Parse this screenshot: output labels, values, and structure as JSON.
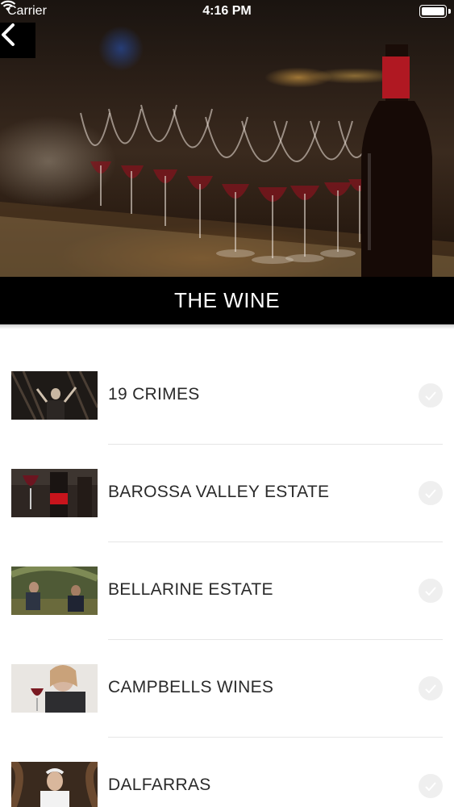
{
  "status_bar": {
    "carrier": "Carrier",
    "time": "4:16 PM"
  },
  "header": {
    "back_icon": "chevron-left-icon",
    "title": "THE WINE"
  },
  "wineries": [
    {
      "name": "19 CRIMES",
      "thumbnail": "photo-man-in-dark-studio",
      "checked": false
    },
    {
      "name": "BAROSSA VALLEY ESTATE",
      "thumbnail": "photo-wine-glass-and-bottle",
      "checked": false
    },
    {
      "name": "BELLARINE ESTATE",
      "thumbnail": "photo-people-in-vineyard",
      "checked": false
    },
    {
      "name": "CAMPBELLS WINES",
      "thumbnail": "photo-woman-tasting-wine",
      "checked": false
    },
    {
      "name": "DALFARRAS",
      "thumbnail": "photo-man-in-cellar",
      "checked": false
    }
  ],
  "colors": {
    "title_band": "#000000",
    "label_text": "#2a2a2a",
    "check_circle": "#efefef",
    "divider": "#e6e6e6"
  }
}
